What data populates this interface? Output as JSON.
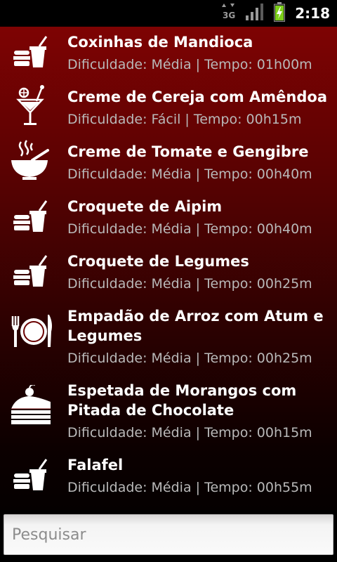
{
  "status_bar": {
    "network": "3G",
    "time": "2:18"
  },
  "recipes": [
    {
      "icon": "fast-food-icon",
      "title": "Coxinhas de Mandioca",
      "meta": "Dificuldade: Média | Tempo: 01h00m"
    },
    {
      "icon": "cocktail-icon",
      "title": "Creme de Cereja com Amêndoa",
      "meta": "Dificuldade: Fácil | Tempo: 00h15m"
    },
    {
      "icon": "soup-bowl-icon",
      "title": "Creme de Tomate e Gengibre",
      "meta": "Dificuldade: Média | Tempo: 00h40m"
    },
    {
      "icon": "fast-food-icon",
      "title": "Croquete de Aipim",
      "meta": "Dificuldade: Média | Tempo: 00h40m"
    },
    {
      "icon": "fast-food-icon",
      "title": "Croquete de Legumes",
      "meta": "Dificuldade: Média | Tempo: 00h25m"
    },
    {
      "icon": "plate-cutlery-icon",
      "title": "Empadão de Arroz com Atum e Legumes",
      "meta": "Dificuldade: Média | Tempo: 00h25m"
    },
    {
      "icon": "cake-slice-icon",
      "title": "Espetada de Morangos com Pitada de Chocolate",
      "meta": "Dificuldade: Média | Tempo: 00h15m"
    },
    {
      "icon": "fast-food-icon",
      "title": "Falafel",
      "meta": "Dificuldade: Média | Tempo: 00h55m"
    }
  ],
  "search": {
    "placeholder": "Pesquisar",
    "value": ""
  }
}
